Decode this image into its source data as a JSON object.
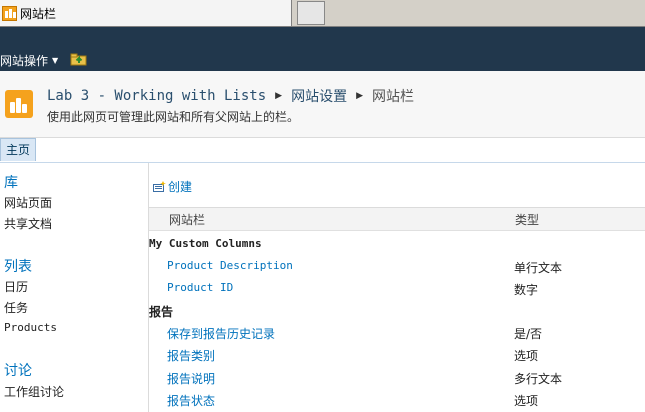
{
  "browser": {
    "tab_title": "网站栏"
  },
  "ribbon": {
    "site_actions": "网站操作"
  },
  "title_area": {
    "breadcrumb": [
      "Lab 3 - Working with Lists",
      "网站设置",
      "网站栏"
    ],
    "description": "使用此网页可管理此网站和所有父网站上的栏。"
  },
  "top_nav": {
    "home": "主页"
  },
  "quick_launch": {
    "sections": [
      {
        "heading": "库",
        "items": [
          "网站页面",
          "共享文档"
        ]
      },
      {
        "heading": "列表",
        "items": [
          "日历",
          "任务",
          "Products"
        ]
      },
      {
        "heading": "讨论",
        "items": [
          "工作组讨论"
        ]
      }
    ]
  },
  "toolbar": {
    "create": "创建"
  },
  "columns": {
    "name_header": "网站栏",
    "type_header": "类型"
  },
  "groups": [
    {
      "name": "My Custom Columns",
      "rows": [
        {
          "name": "Product Description",
          "type": "单行文本"
        },
        {
          "name": "Product ID",
          "type": "数字"
        }
      ]
    },
    {
      "name": "报告",
      "rows": [
        {
          "name": "保存到报告历史记录",
          "type": "是/否"
        },
        {
          "name": "报告类别",
          "type": "选项"
        },
        {
          "name": "报告说明",
          "type": "多行文本"
        },
        {
          "name": "报告状态",
          "type": "选项"
        }
      ]
    }
  ],
  "colors": {
    "ribbon_bg": "#21374c",
    "link": "#0072bc",
    "brand_orange": "#f5a21d"
  },
  "icons": [
    "favicon-icon",
    "caret-down-icon",
    "navigate-up-icon",
    "site-logo-icon",
    "breadcrumb-arrow-icon",
    "new-item-icon"
  ]
}
